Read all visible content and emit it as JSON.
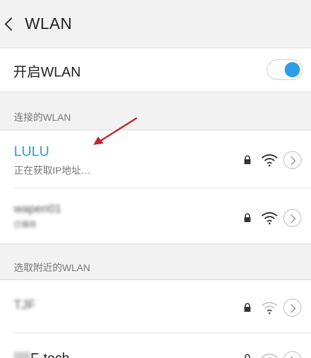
{
  "header": {
    "title": "WLAN",
    "back_icon": "chevron-left-icon"
  },
  "wlan_toggle": {
    "label": "开启WLAN",
    "state": "on",
    "accent_color": "#2d9ee6"
  },
  "connected_section": {
    "header": "连接的WLAN",
    "networks": [
      {
        "name": "LULU",
        "status": "正在获取IP地址…",
        "secured": true,
        "signal_level": "full",
        "state": "connecting"
      },
      {
        "name": "wapen01",
        "status": "已保存",
        "secured": true,
        "signal_level": "full",
        "obscured": true
      }
    ]
  },
  "nearby_section": {
    "header": "选取附近的WLAN",
    "networks": [
      {
        "name": "TJF",
        "secured": true,
        "signal_level": "weak",
        "obscured": true
      },
      {
        "name": "F-tech",
        "secured": true,
        "signal_level": "weak",
        "partially_obscured": true,
        "visible_suffix": "F-tech"
      }
    ]
  },
  "colors": {
    "link_blue": "#2a9bd9",
    "annotation_arrow": "#c0262d"
  }
}
